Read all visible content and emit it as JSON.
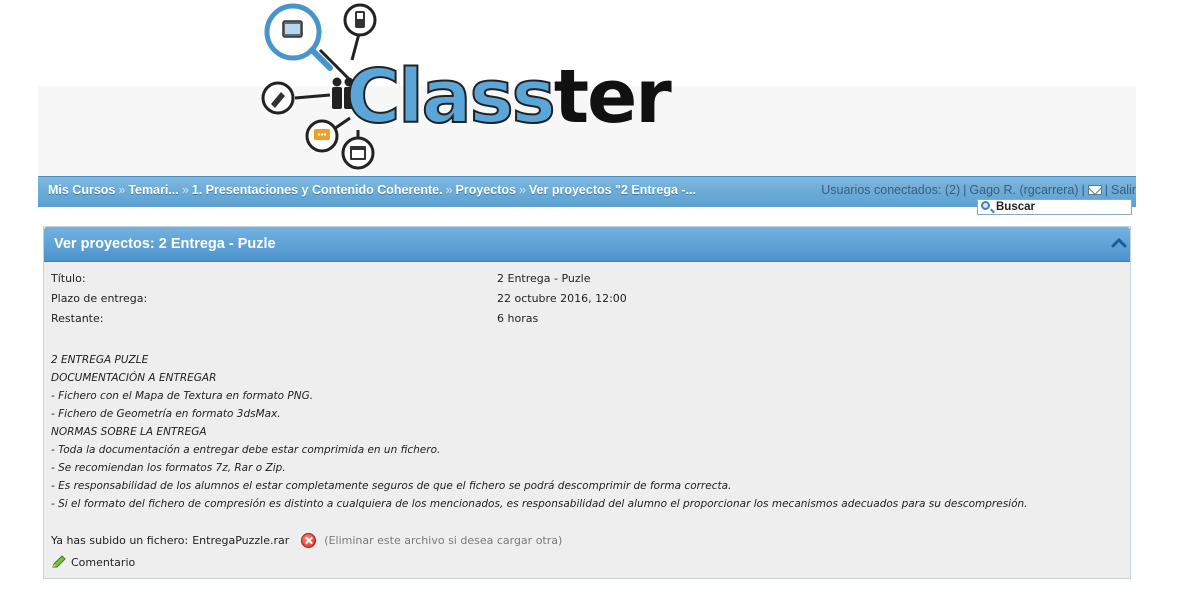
{
  "logo": {
    "word_part1": "Class",
    "word_part2": "ter"
  },
  "breadcrumb": [
    {
      "label": "Mis Cursos"
    },
    {
      "label": "Temari..."
    },
    {
      "label": "1. Presentaciones y Contenido Coherente."
    },
    {
      "label": "Proyectos"
    },
    {
      "label": "Ver proyectos \"2 Entrega -..."
    }
  ],
  "breadcrumb_separator": "»",
  "userbar": {
    "connected": "Usuarios conectados: (2)",
    "user": "Gago R. (rgcarrera)",
    "logout": "Salir"
  },
  "search": {
    "label": "Buscar"
  },
  "panel": {
    "title": "Ver proyectos: 2 Entrega - Puzle",
    "fields": [
      {
        "label": "Título:",
        "value": "2 Entrega - Puzle"
      },
      {
        "label": "Plazo de entrega:",
        "value": "22 octubre 2016, 12:00"
      },
      {
        "label": "Restante:",
        "value": "6 horas"
      }
    ],
    "description": [
      "2 ENTREGA PUZLE",
      "DOCUMENTACIÓN A ENTREGAR",
      "- Fichero con el Mapa de Textura en formato PNG.",
      "- Fichero de Geometría en formato 3dsMax.",
      "NORMAS SOBRE LA ENTREGA",
      "- Toda la documentación a entregar debe estar comprimida en un fichero.",
      "- Se recomiendan los formatos 7z, Rar o Zip.",
      "- Es responsabilidad de los alumnos el estar completamente seguros de que el fichero se podrá descomprimir de forma correcta.",
      "- Si el formato del fichero de compresión es distinto a cualquiera de los mencionados, es responsabilidad del alumno el proporcionar los mecanismos adecuados para su descompresión."
    ],
    "upload": {
      "prefix": "Ya has subido un fichero:",
      "filename": "EntregaPuzzle.rar",
      "delete_hint": "(Eliminar este archivo si desea cargar otra)"
    },
    "comment_label": "Comentario"
  },
  "colors": {
    "nav_blue": "#5b9fd0",
    "panel_bg": "#eeeeee",
    "delete_red": "#d9261c"
  }
}
